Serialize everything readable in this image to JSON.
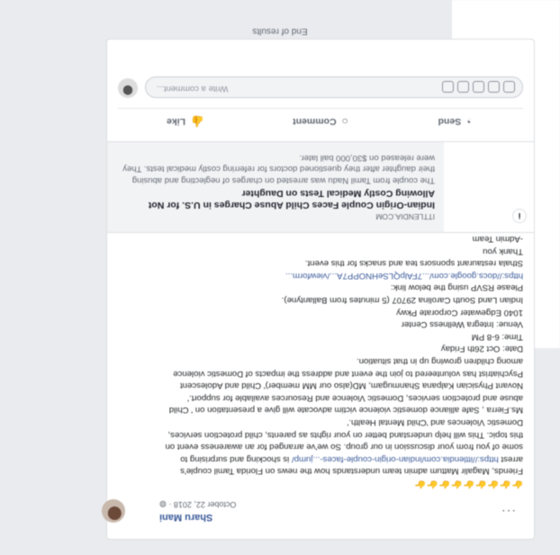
{
  "post": {
    "author": "Sharu Mani",
    "date": "October 22, 2018 · ◍",
    "more": "···",
    "body_lines": [
      {
        "type": "emoji",
        "text": "👉👉👉👉👉👉👉👉👉"
      },
      {
        "type": "text",
        "text": "Friends, Magalir Mattum admin team understands how the news on Florida Tamil couple's"
      },
      {
        "type": "mixed",
        "before": "arrest ",
        "link": "https://ittlendia.com/indian-origin-couple-faces-...jump/",
        "after": " is shocking and surprising to"
      },
      {
        "type": "text",
        "text": "some of you from your discussion in our group. So we've arranged for an awareness event on"
      },
      {
        "type": "text",
        "text": "this topic.  This will help understand better on your rights as parents, child protection services,"
      },
      {
        "type": "text",
        "text": "Domestic Violences and 'Child Mental Health.'"
      },
      {
        "type": "text",
        "text": "Ms.Fierra , Safe alliance domestic violence victim advocate will give a presentation on ' Child"
      },
      {
        "type": "text",
        "text": "abuse and protection services, Domestic Violence and Resources available for support.'"
      },
      {
        "type": "text",
        "text": "Novant Physician Kalpana Shanmugam, MD(also our MM member)' Child and Adolescent"
      },
      {
        "type": "text",
        "text": "Psychiatrist has volunteered to join the event and address the impacts of Domestic violence"
      },
      {
        "type": "text",
        "text": "among children growing up in that situation."
      },
      {
        "type": "text",
        "text": "Date: Oct 26th Friday"
      },
      {
        "type": "text",
        "text": "Time: 6-8 PM"
      },
      {
        "type": "text",
        "text": "Venue: Integra Wellness Center"
      },
      {
        "type": "text",
        "text": "1040 Edgewater Corporate Pkwy"
      },
      {
        "type": "text",
        "text": "Indian Land South Carolina 29707 (5 minutes from Ballantyne)."
      },
      {
        "type": "text",
        "text": "Please RSVP using the below link:"
      },
      {
        "type": "link",
        "text": "https://docs.google.com/...7FAlpQLSeHNOPP7A.../viewform..."
      },
      {
        "type": "text",
        "text": "Sthala restaurant sponsors tea and snacks for this event."
      },
      {
        "type": "text",
        "text": "Thank you"
      },
      {
        "type": "text",
        "text": "-Admin Team"
      },
      {
        "type": "emoji",
        "text": "👉👉👉👉👉👉👉👉👉👉👉👉"
      }
    ]
  },
  "preview": {
    "domain": "ITTLENDIA.COM",
    "title": "Indian-Origin Couple Faces Child Abuse Charges in U.S. for Not Allowing Costly Medical Tests on Daughter",
    "description": "The couple from Tamil Nadu was arrested on charges of neglecting and abusing their daughter after they questioned doctors for referring costly medical tests. They were released on $30,000 bail later.",
    "info_icon": "i"
  },
  "actions": {
    "like": "Like",
    "comment": "Comment",
    "send": "Send",
    "like_icon": "thumbs-up-icon",
    "comment_icon": "speech-bubble-icon",
    "send_icon": "messenger-icon"
  },
  "comment_box": {
    "placeholder": "Write a comment..."
  },
  "footer": {
    "end_results": "End of results"
  }
}
